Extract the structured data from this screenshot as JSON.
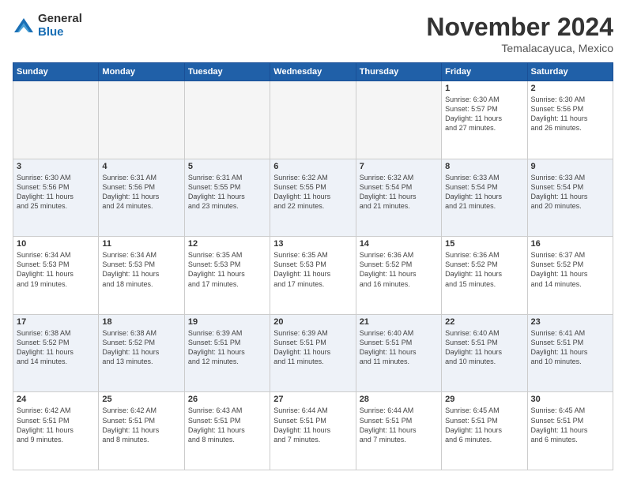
{
  "logo": {
    "general": "General",
    "blue": "Blue"
  },
  "title": "November 2024",
  "location": "Temalacayuca, Mexico",
  "days_of_week": [
    "Sunday",
    "Monday",
    "Tuesday",
    "Wednesday",
    "Thursday",
    "Friday",
    "Saturday"
  ],
  "weeks": [
    [
      {
        "day": "",
        "info": "",
        "empty": true
      },
      {
        "day": "",
        "info": "",
        "empty": true
      },
      {
        "day": "",
        "info": "",
        "empty": true
      },
      {
        "day": "",
        "info": "",
        "empty": true
      },
      {
        "day": "",
        "info": "",
        "empty": true
      },
      {
        "day": "1",
        "info": "Sunrise: 6:30 AM\nSunset: 5:57 PM\nDaylight: 11 hours\nand 27 minutes."
      },
      {
        "day": "2",
        "info": "Sunrise: 6:30 AM\nSunset: 5:56 PM\nDaylight: 11 hours\nand 26 minutes."
      }
    ],
    [
      {
        "day": "3",
        "info": "Sunrise: 6:30 AM\nSunset: 5:56 PM\nDaylight: 11 hours\nand 25 minutes."
      },
      {
        "day": "4",
        "info": "Sunrise: 6:31 AM\nSunset: 5:56 PM\nDaylight: 11 hours\nand 24 minutes."
      },
      {
        "day": "5",
        "info": "Sunrise: 6:31 AM\nSunset: 5:55 PM\nDaylight: 11 hours\nand 23 minutes."
      },
      {
        "day": "6",
        "info": "Sunrise: 6:32 AM\nSunset: 5:55 PM\nDaylight: 11 hours\nand 22 minutes."
      },
      {
        "day": "7",
        "info": "Sunrise: 6:32 AM\nSunset: 5:54 PM\nDaylight: 11 hours\nand 21 minutes."
      },
      {
        "day": "8",
        "info": "Sunrise: 6:33 AM\nSunset: 5:54 PM\nDaylight: 11 hours\nand 21 minutes."
      },
      {
        "day": "9",
        "info": "Sunrise: 6:33 AM\nSunset: 5:54 PM\nDaylight: 11 hours\nand 20 minutes."
      }
    ],
    [
      {
        "day": "10",
        "info": "Sunrise: 6:34 AM\nSunset: 5:53 PM\nDaylight: 11 hours\nand 19 minutes."
      },
      {
        "day": "11",
        "info": "Sunrise: 6:34 AM\nSunset: 5:53 PM\nDaylight: 11 hours\nand 18 minutes."
      },
      {
        "day": "12",
        "info": "Sunrise: 6:35 AM\nSunset: 5:53 PM\nDaylight: 11 hours\nand 17 minutes."
      },
      {
        "day": "13",
        "info": "Sunrise: 6:35 AM\nSunset: 5:53 PM\nDaylight: 11 hours\nand 17 minutes."
      },
      {
        "day": "14",
        "info": "Sunrise: 6:36 AM\nSunset: 5:52 PM\nDaylight: 11 hours\nand 16 minutes."
      },
      {
        "day": "15",
        "info": "Sunrise: 6:36 AM\nSunset: 5:52 PM\nDaylight: 11 hours\nand 15 minutes."
      },
      {
        "day": "16",
        "info": "Sunrise: 6:37 AM\nSunset: 5:52 PM\nDaylight: 11 hours\nand 14 minutes."
      }
    ],
    [
      {
        "day": "17",
        "info": "Sunrise: 6:38 AM\nSunset: 5:52 PM\nDaylight: 11 hours\nand 14 minutes."
      },
      {
        "day": "18",
        "info": "Sunrise: 6:38 AM\nSunset: 5:52 PM\nDaylight: 11 hours\nand 13 minutes."
      },
      {
        "day": "19",
        "info": "Sunrise: 6:39 AM\nSunset: 5:51 PM\nDaylight: 11 hours\nand 12 minutes."
      },
      {
        "day": "20",
        "info": "Sunrise: 6:39 AM\nSunset: 5:51 PM\nDaylight: 11 hours\nand 11 minutes."
      },
      {
        "day": "21",
        "info": "Sunrise: 6:40 AM\nSunset: 5:51 PM\nDaylight: 11 hours\nand 11 minutes."
      },
      {
        "day": "22",
        "info": "Sunrise: 6:40 AM\nSunset: 5:51 PM\nDaylight: 11 hours\nand 10 minutes."
      },
      {
        "day": "23",
        "info": "Sunrise: 6:41 AM\nSunset: 5:51 PM\nDaylight: 11 hours\nand 10 minutes."
      }
    ],
    [
      {
        "day": "24",
        "info": "Sunrise: 6:42 AM\nSunset: 5:51 PM\nDaylight: 11 hours\nand 9 minutes."
      },
      {
        "day": "25",
        "info": "Sunrise: 6:42 AM\nSunset: 5:51 PM\nDaylight: 11 hours\nand 8 minutes."
      },
      {
        "day": "26",
        "info": "Sunrise: 6:43 AM\nSunset: 5:51 PM\nDaylight: 11 hours\nand 8 minutes."
      },
      {
        "day": "27",
        "info": "Sunrise: 6:44 AM\nSunset: 5:51 PM\nDaylight: 11 hours\nand 7 minutes."
      },
      {
        "day": "28",
        "info": "Sunrise: 6:44 AM\nSunset: 5:51 PM\nDaylight: 11 hours\nand 7 minutes."
      },
      {
        "day": "29",
        "info": "Sunrise: 6:45 AM\nSunset: 5:51 PM\nDaylight: 11 hours\nand 6 minutes."
      },
      {
        "day": "30",
        "info": "Sunrise: 6:45 AM\nSunset: 5:51 PM\nDaylight: 11 hours\nand 6 minutes."
      }
    ]
  ]
}
